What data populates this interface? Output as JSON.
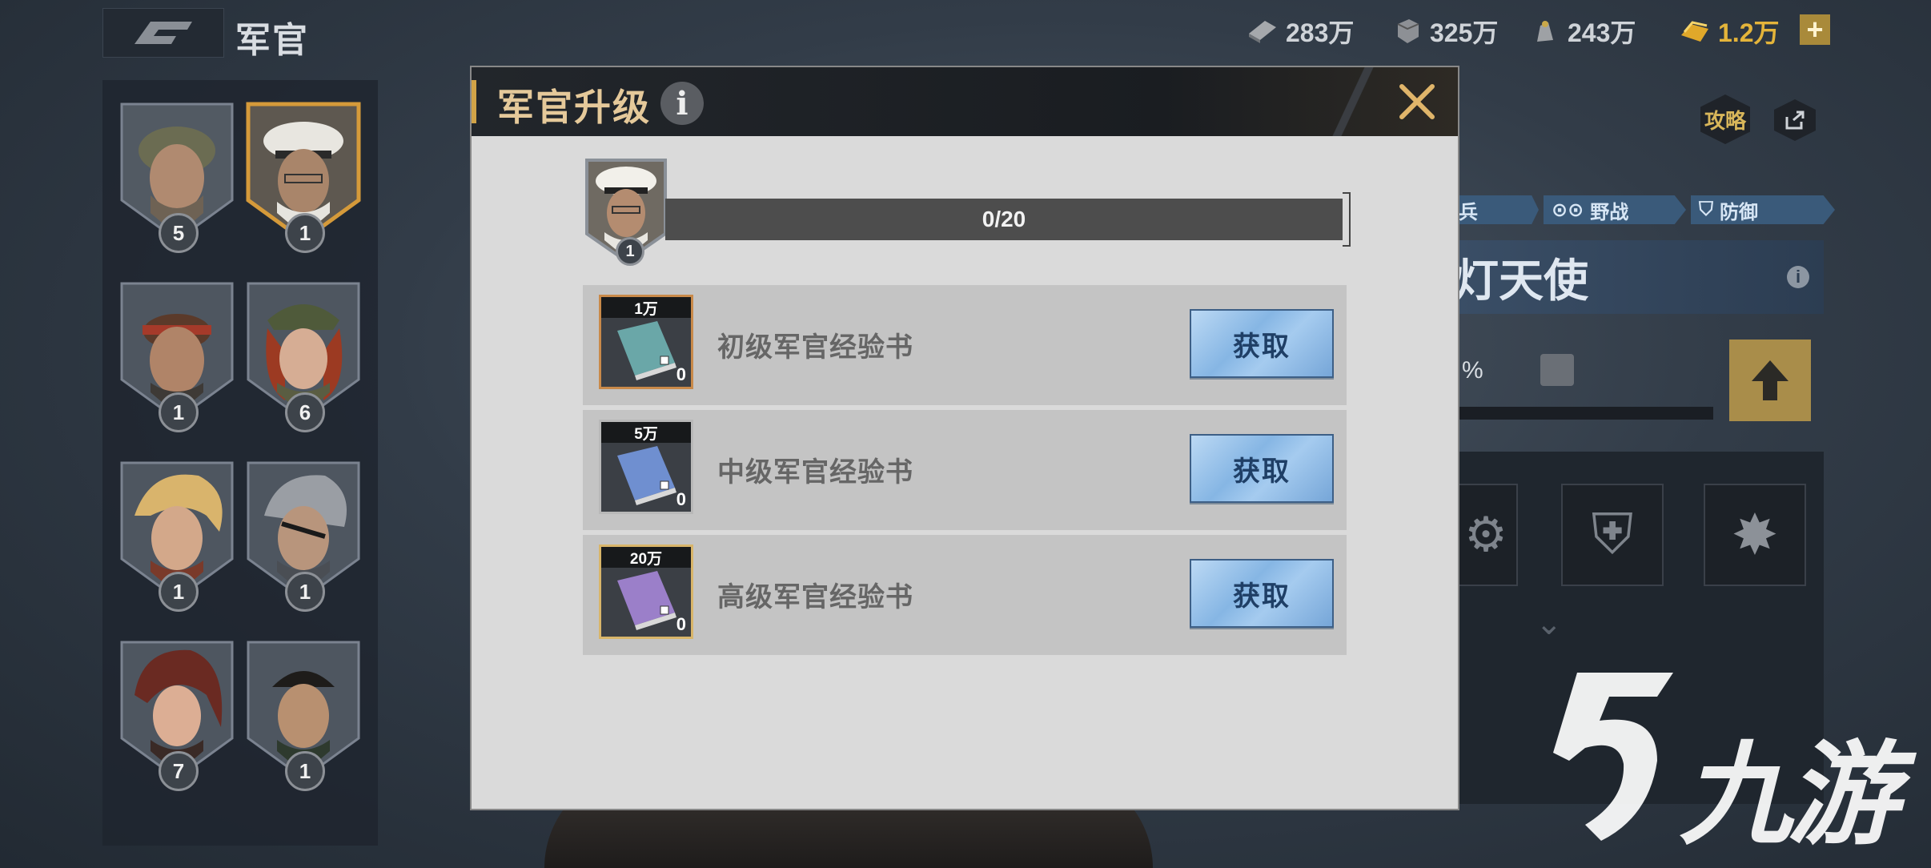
{
  "header": {
    "page_title": "军官",
    "resources": [
      {
        "icon": "supply-crate-icon",
        "value": "283万"
      },
      {
        "icon": "steel-icon",
        "value": "325万"
      },
      {
        "icon": "oil-icon",
        "value": "243万"
      },
      {
        "icon": "gold-bars-icon",
        "value": "1.2万"
      }
    ],
    "add_label": "+"
  },
  "officers": [
    {
      "level": "5",
      "style": "helmet"
    },
    {
      "level": "1",
      "style": "navy-cap",
      "selected": true
    },
    {
      "level": "1",
      "style": "headband"
    },
    {
      "level": "6",
      "style": "redhair-cap"
    },
    {
      "level": "1",
      "style": "blonde"
    },
    {
      "level": "1",
      "style": "eyepatch"
    },
    {
      "level": "7",
      "style": "redhair"
    },
    {
      "level": "1",
      "style": "soldier"
    }
  ],
  "right_panel": {
    "guide_label": "攻略",
    "tags": [
      "兵",
      "野战",
      "防御"
    ],
    "officer_name": "灯天使",
    "percent_label": "%"
  },
  "modal": {
    "title": "军官升级",
    "info_label": "i",
    "officer_level": "1",
    "progress_text": "0/20",
    "progress_fraction": 0,
    "items": [
      {
        "price": "1万",
        "name": "初级军官经验书",
        "count": "0",
        "button": "获取",
        "book_color": "#6aa7a8",
        "frame_color": "#c98a4a"
      },
      {
        "price": "5万",
        "name": "中级军官经验书",
        "count": "0",
        "button": "获取",
        "book_color": "#6f8fd0",
        "frame_color": "#b8b8b8"
      },
      {
        "price": "20万",
        "name": "高级军官经验书",
        "count": "0",
        "button": "获取",
        "book_color": "#9b7fc9",
        "frame_color": "#d8b56a"
      }
    ]
  },
  "watermark": {
    "text": "九游"
  }
}
